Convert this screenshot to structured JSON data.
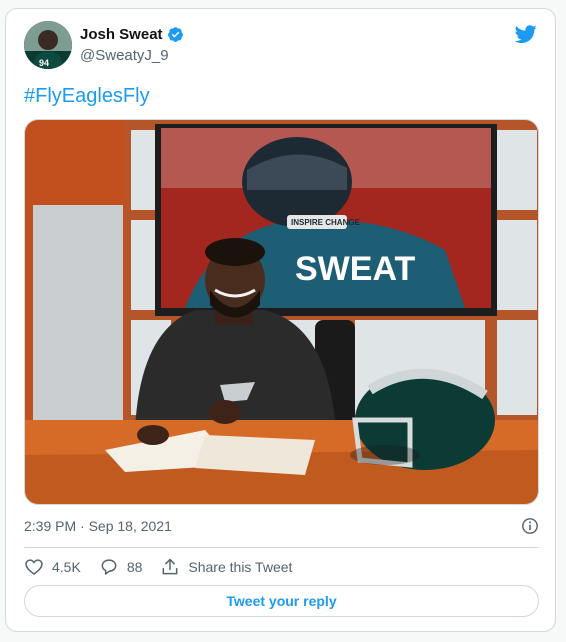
{
  "user": {
    "name": "Josh Sweat",
    "handle": "@SweatyJ_9",
    "verified": true
  },
  "tweet": {
    "text": "#FlyEaglesFly",
    "timestamp": "2:39 PM · Sep 18, 2021"
  },
  "media": {
    "jersey_text": "SWEAT",
    "helmet_band_text": "INSPIRE CHANGE"
  },
  "actions": {
    "likes": "4.5K",
    "replies": "88",
    "share_label": "Share this Tweet"
  },
  "reply_button_label": "Tweet your reply",
  "colors": {
    "twitter_blue": "#1d9bf0",
    "muted_text": "#536471",
    "border": "#cfd9de"
  }
}
